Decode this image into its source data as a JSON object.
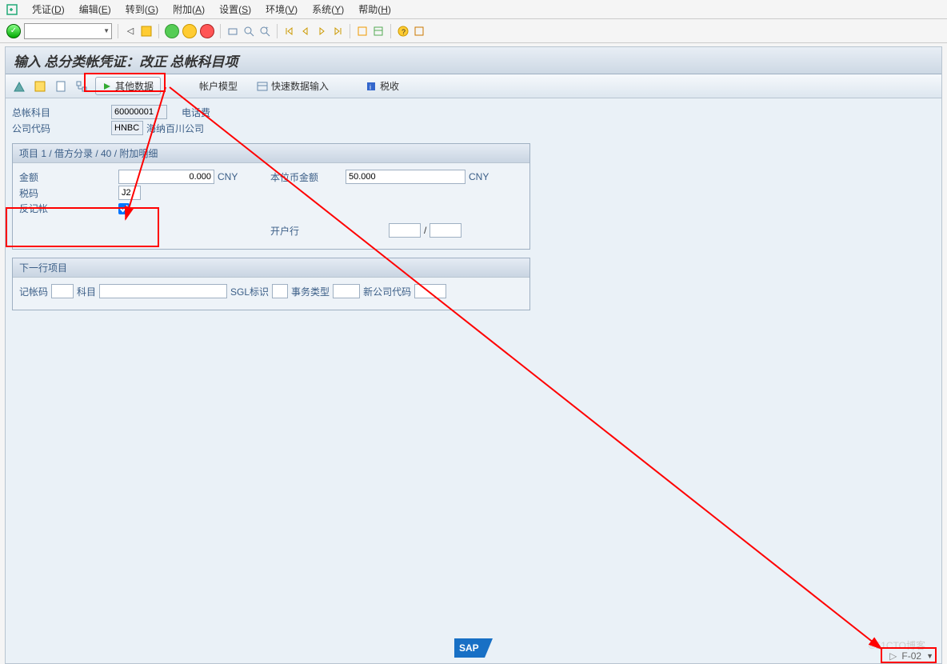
{
  "menu": {
    "icon": "menu-icon",
    "items": [
      {
        "label": "凭证",
        "key": "D"
      },
      {
        "label": "编辑",
        "key": "E"
      },
      {
        "label": "转到",
        "key": "G"
      },
      {
        "label": "附加",
        "key": "A"
      },
      {
        "label": "设置",
        "key": "S"
      },
      {
        "label": "环境",
        "key": "V"
      },
      {
        "label": "系统",
        "key": "Y"
      },
      {
        "label": "帮助",
        "key": "H"
      }
    ]
  },
  "toolbar_icons": {
    "ok": "✓",
    "back": "◁",
    "save": "💾",
    "exit": "✖",
    "cancel": "⊘",
    "stop": "⊗",
    "grp_print": "🖨",
    "find": "🔍",
    "find_next": "🔎",
    "first": "⏮",
    "prev": "⏪",
    "next": "⏩",
    "last": "⏭",
    "new": "📋",
    "layout": "🗂",
    "help": "❓",
    "custom": "📑"
  },
  "page_title": "输入 总分类帐凭证：改正 总帐科目项",
  "app_toolbar": {
    "btn1": "icon-user",
    "btn2": "icon-doc",
    "btn3": "icon-list",
    "btn4": "icon-graph",
    "other_data_label": "其他数据",
    "account_model_label": "帐户模型",
    "fast_entry_label": "快速数据输入",
    "tax_label": "税收"
  },
  "header_fields": {
    "gl_account_label": "总帐科目",
    "gl_account_value": "60000001",
    "gl_account_text": "电话费",
    "company_code_label": "公司代码",
    "company_code_value": "HNBC",
    "company_code_text": "海纳百川公司"
  },
  "item_group": {
    "header": "项目 1 / 借方分录 / 40 / 附加明细",
    "amount_label": "金额",
    "amount_value": "0.000",
    "amount_curr": "CNY",
    "local_amount_label": "本位币金额",
    "local_amount_value": "50.000",
    "local_amount_curr": "CNY",
    "tax_code_label": "税码",
    "tax_code_value": "J2",
    "reverse_posting_label": "反记帐",
    "reverse_posting_checked": true,
    "bank_label": "开户行",
    "slash": "/"
  },
  "next_item": {
    "header": "下一行项目",
    "posting_key_label": "记帐码",
    "account_label": "科目",
    "sgl_label": "SGL标识",
    "trans_type_label": "事务类型",
    "new_company_label": "新公司代码"
  },
  "footer": {
    "brand": "SAP",
    "tcode": "F-02",
    "watermark": "©51CTO博客"
  }
}
